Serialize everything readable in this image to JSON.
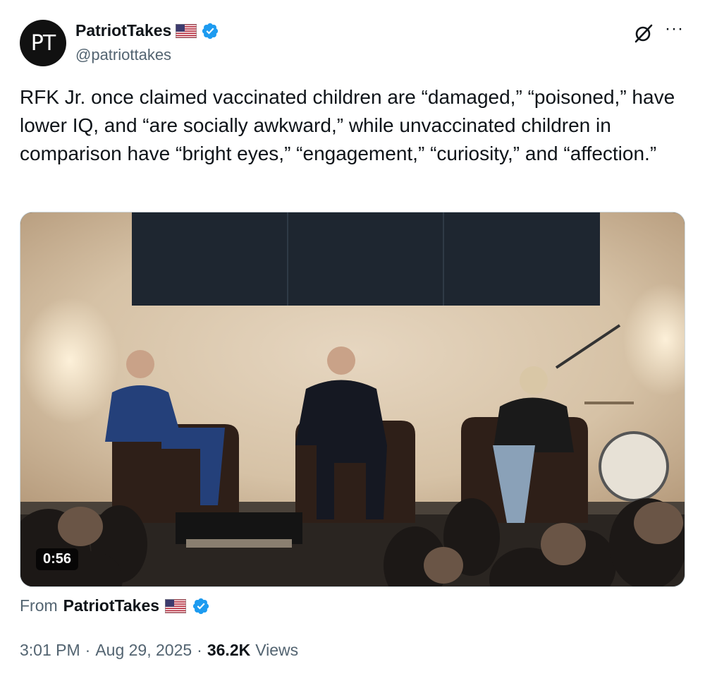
{
  "author": {
    "avatar_text": "PT",
    "display_name": "PatriotTakes",
    "handle": "@patriottakes",
    "flag_emoji_icon": "us-flag-icon",
    "verified_icon": "verified-badge-icon",
    "verified_color": "#1d9bf0"
  },
  "header_actions": {
    "grok_icon": "grok-icon",
    "more_icon": "more-options-icon",
    "more_label": "···"
  },
  "tweet": {
    "text": "RFK Jr. once claimed vaccinated children are “damaged,” “poisoned,” have lower IQ, and “are socially awkward,” while unvaccinated children in comparison have “bright eyes,” “engagement,” “curiosity,” and “affection.”"
  },
  "media": {
    "type": "video",
    "duration": "0:56"
  },
  "attribution": {
    "from_label": "From",
    "source_name": "PatriotTakes"
  },
  "meta": {
    "time": "3:01 PM",
    "separator": "·",
    "date": "Aug 29, 2025",
    "views_count": "36.2K",
    "views_label": "Views"
  }
}
